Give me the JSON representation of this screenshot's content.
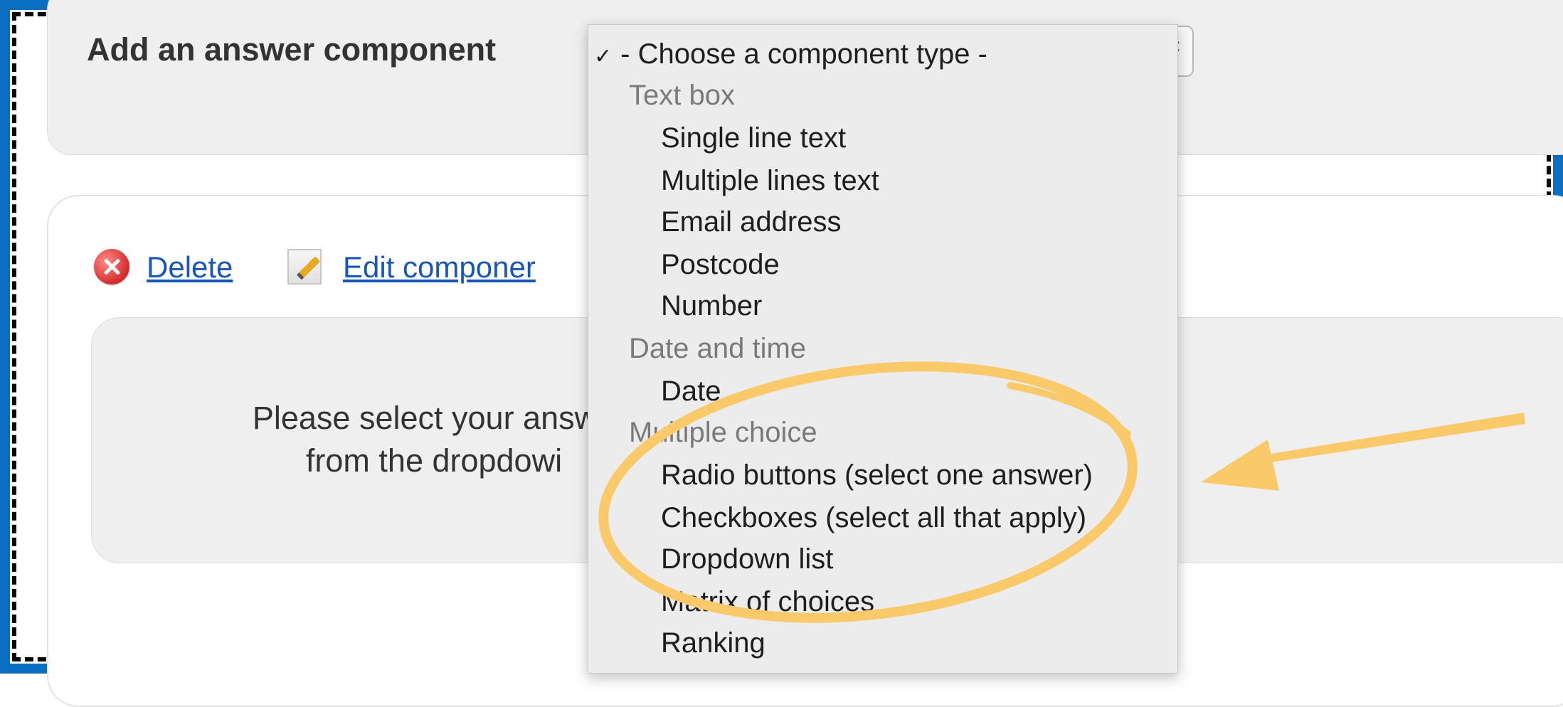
{
  "add_component": {
    "label": "Add an answer component"
  },
  "actions": {
    "delete_label": "Delete",
    "edit_label": "Edit componer"
  },
  "placeholder": {
    "line1": "Please select your answe",
    "line2": "from the dropdowi"
  },
  "dropdown": {
    "selected": {
      "check": "✓",
      "label": "- Choose a component type -"
    },
    "groups": [
      {
        "label": "Text box",
        "items": [
          "Single line text",
          "Multiple lines text",
          "Email address",
          "Postcode",
          "Number"
        ]
      },
      {
        "label": "Date and time",
        "items": [
          "Date"
        ]
      },
      {
        "label": "Multiple choice",
        "items": [
          "Radio buttons (select one answer)",
          "Checkboxes (select all that apply)",
          "Dropdown list",
          "Matrix of choices",
          "Ranking"
        ]
      }
    ]
  },
  "colors": {
    "frame": "#0a6fc0",
    "highlight": "#f9c96a",
    "link": "#1a56b8"
  },
  "icons": {
    "delete": "delete-icon",
    "edit": "pencil-icon",
    "select": "select-arrows-icon",
    "highlight_arrow": "arrow-left-icon"
  }
}
